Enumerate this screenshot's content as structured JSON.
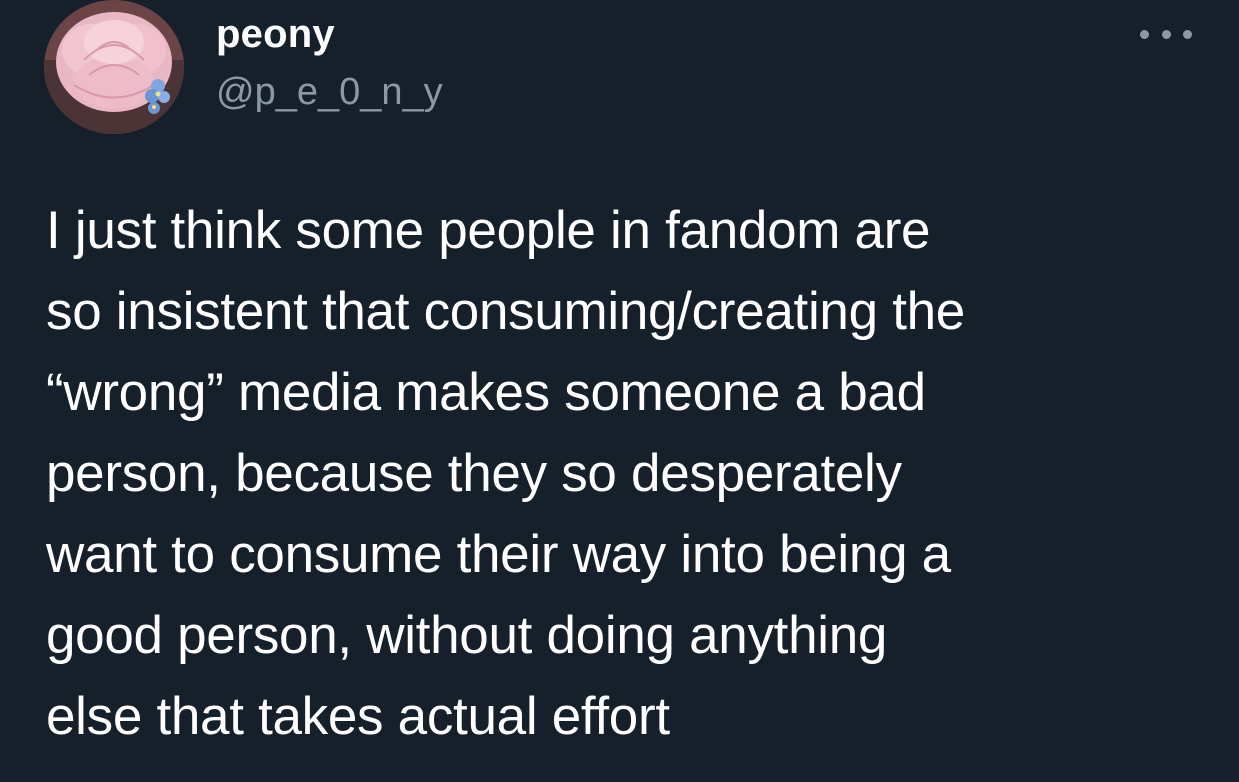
{
  "tweet": {
    "display_name": "peony",
    "handle": "@p_e_0_n_y",
    "more_icon": "ellipsis-icon",
    "avatar_icon": "peony-flower-avatar",
    "text": "I just think some people in fandom are\nso insistent that consuming/creating the\n“wrong” media makes someone a bad\nperson, because they so desperately\nwant to consume their way into being a\ngood person, without doing anything\nelse that takes actual effort"
  },
  "colors": {
    "background": "#16202b",
    "primary_text": "#ffffff",
    "secondary_text": "#8b98a5"
  }
}
